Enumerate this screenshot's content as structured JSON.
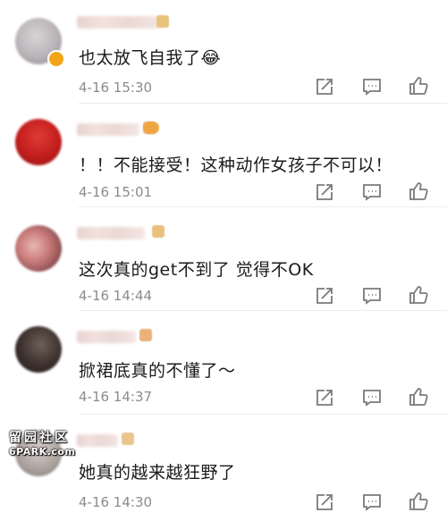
{
  "comments": [
    {
      "text": "也太放飞自我了😂",
      "time": "4-16 15:30"
    },
    {
      "text": "！！不能接受！这种动作女孩子不可以！",
      "time": "4-16 15:01"
    },
    {
      "text": "这次真的get不到了 觉得不OK",
      "time": "4-16 14:44"
    },
    {
      "text": "掀裙底真的不懂了～",
      "time": "4-16 14:37"
    },
    {
      "text": "她真的越来越狂野了",
      "time": "4-16 14:30"
    }
  ],
  "watermark": {
    "line1": "留园社区",
    "line2": "6PARK.com"
  },
  "icons": {
    "share": "share-icon",
    "comment": "comment-icon",
    "like": "thumbs-up-icon"
  },
  "colors": {
    "text": "#1b1b1b",
    "time": "#8b8b8b",
    "icon": "#7a7a7a",
    "divider": "#ececec"
  }
}
